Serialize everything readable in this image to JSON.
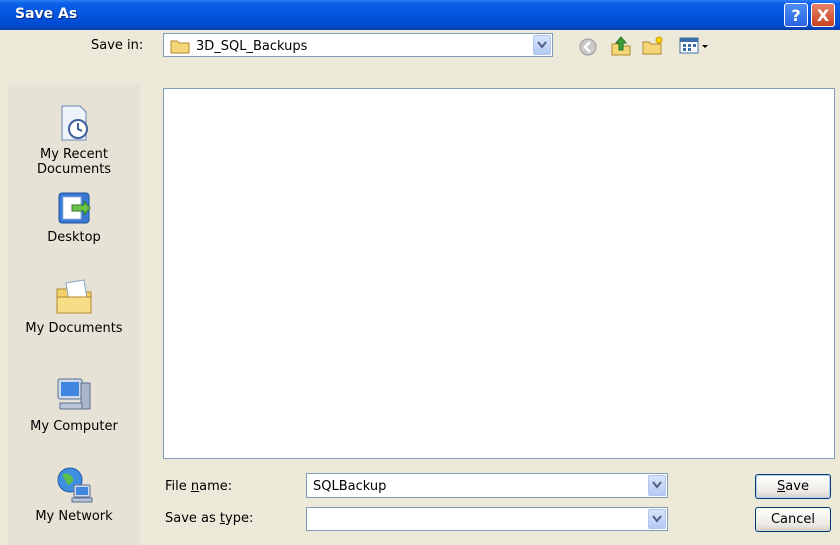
{
  "window": {
    "title": "Save As",
    "help_label": "?",
    "close_label": "X"
  },
  "toolbar": {
    "save_in_label": "Save in:",
    "current_folder": "3D_SQL_Backups"
  },
  "places": [
    {
      "label_line1": "My Recent",
      "label_line2": "Documents",
      "icon": "recent-documents-icon"
    },
    {
      "label_line1": "Desktop",
      "label_line2": "",
      "icon": "desktop-icon"
    },
    {
      "label_line1": "My Documents",
      "label_line2": "",
      "icon": "my-documents-icon"
    },
    {
      "label_line1": "My Computer",
      "label_line2": "",
      "icon": "my-computer-icon"
    },
    {
      "label_line1": "My Network",
      "label_line2": "",
      "icon": "my-network-icon"
    }
  ],
  "form": {
    "file_name_label_pre": "File ",
    "file_name_label_u": "n",
    "file_name_label_post": "ame:",
    "file_name_value": "SQLBackup",
    "save_as_type_label_pre": "Save as ",
    "save_as_type_label_u": "t",
    "save_as_type_label_post": "ype:",
    "save_as_type_value": ""
  },
  "buttons": {
    "save_u": "S",
    "save_rest": "ave",
    "cancel": "Cancel"
  }
}
